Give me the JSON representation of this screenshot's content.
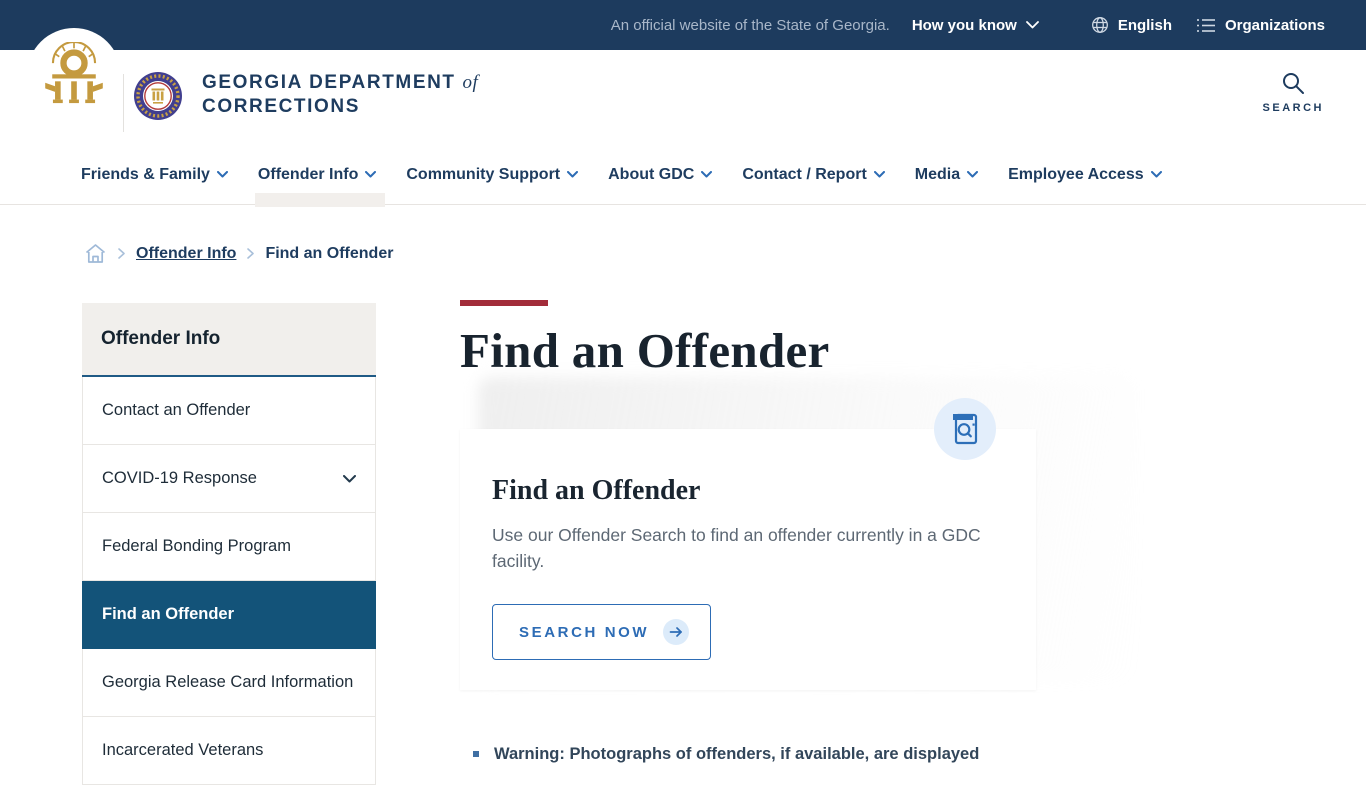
{
  "colors": {
    "topbar_navy": "#1d3b5e",
    "link_blue": "#2d6cb5",
    "active_sidebar": "#135379",
    "accent_red": "#a22c3a",
    "logo_gold": "#c49a3f"
  },
  "official_bar": {
    "message": "An official website of the State of Georgia.",
    "how_you_know": "How you know",
    "language": "English",
    "organizations": "Organizations"
  },
  "header": {
    "agency_line1": "GEORGIA DEPARTMENT",
    "agency_of": "of",
    "agency_line2": "CORRECTIONS",
    "search_label": "SEARCH"
  },
  "nav": {
    "items": [
      {
        "label": "Friends & Family"
      },
      {
        "label": "Offender Info"
      },
      {
        "label": "Community Support"
      },
      {
        "label": "About GDC"
      },
      {
        "label": "Contact / Report"
      },
      {
        "label": "Media"
      },
      {
        "label": "Employee Access"
      }
    ]
  },
  "breadcrumb": {
    "items": [
      {
        "label": "Offender Info"
      },
      {
        "label": "Find an Offender"
      }
    ]
  },
  "sidebar": {
    "title": "Offender Info",
    "items": [
      {
        "label": "Contact an Offender"
      },
      {
        "label": "COVID-19 Response"
      },
      {
        "label": "Federal Bonding Program"
      },
      {
        "label": "Find an Offender"
      },
      {
        "label": "Georgia Release Card Information"
      },
      {
        "label": "Incarcerated Veterans"
      }
    ]
  },
  "main": {
    "page_title": "Find an Offender",
    "card": {
      "title": "Find an Offender",
      "body": "Use our Offender Search to find an offender currently in a GDC facility.",
      "button_label": "SEARCH NOW"
    },
    "warning": "Warning: Photographs of offenders, if available, are displayed"
  }
}
